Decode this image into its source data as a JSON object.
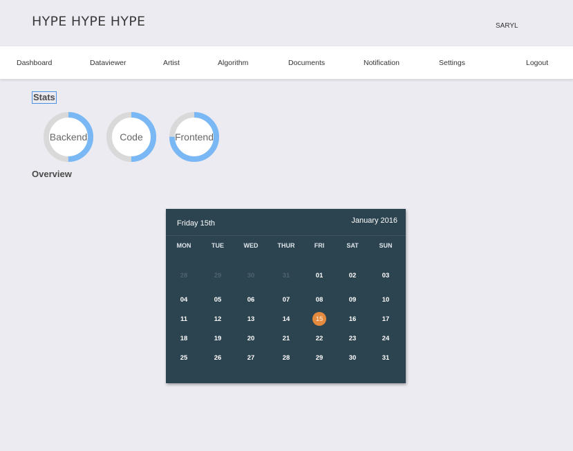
{
  "app": {
    "title": "HYPE HYPE HYPE",
    "user": "SARYL"
  },
  "nav": {
    "items": [
      {
        "label": "Dashboard"
      },
      {
        "label": "Dataviewer"
      },
      {
        "label": "Artist"
      },
      {
        "label": "Algorithm"
      },
      {
        "label": "Documents"
      },
      {
        "label": "Notification"
      },
      {
        "label": "Settings"
      },
      {
        "label": "Logout"
      }
    ]
  },
  "stats": {
    "title": "Stats",
    "donuts": [
      {
        "label": "Backend",
        "progress": 0.5
      },
      {
        "label": "Code",
        "progress": 0.5
      },
      {
        "label": "Frontend",
        "progress": 0.75
      }
    ],
    "colors": {
      "fill": "#7ab8f5",
      "track": "#d9d9d9"
    }
  },
  "overview": {
    "title": "Overview"
  },
  "calendar": {
    "selected_label": "Friday 15th",
    "month_label": "January 2016",
    "weekdays": [
      "MON",
      "TUE",
      "WED",
      "THUR",
      "FRI",
      "SAT",
      "SUN"
    ],
    "weeks": [
      [
        "28",
        "29",
        "30",
        "31",
        "01",
        "02",
        "03"
      ],
      [
        "04",
        "05",
        "06",
        "07",
        "08",
        "09",
        "10"
      ],
      [
        "11",
        "12",
        "13",
        "14",
        "15",
        "16",
        "17"
      ],
      [
        "18",
        "19",
        "20",
        "21",
        "22",
        "23",
        "24"
      ],
      [
        "25",
        "26",
        "27",
        "28",
        "29",
        "30",
        "31"
      ]
    ],
    "muted_days": [
      "28",
      "29",
      "30",
      "31"
    ],
    "selected_day": "15",
    "colors": {
      "background": "#2c4350",
      "selected": "#e38a3e"
    }
  }
}
